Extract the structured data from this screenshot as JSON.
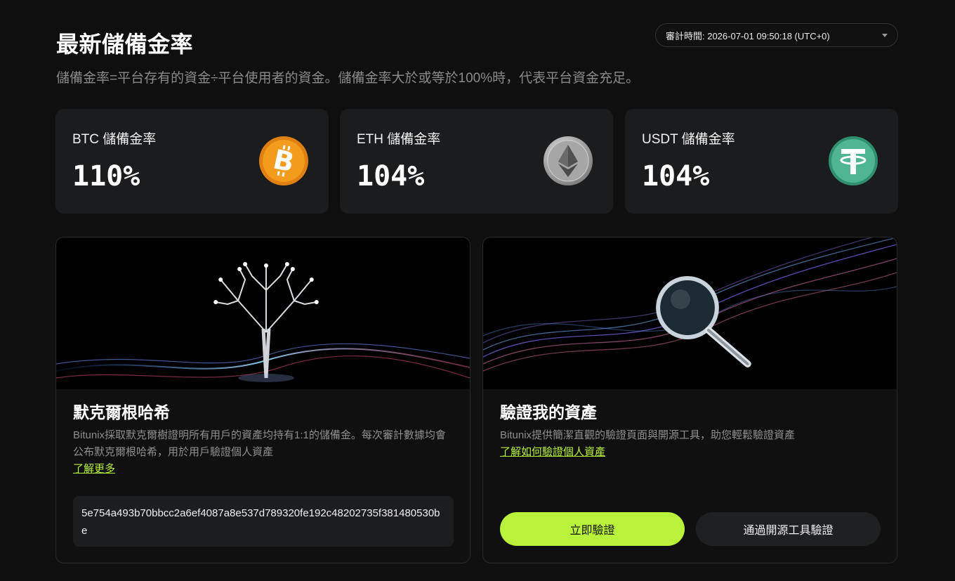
{
  "header": {
    "title": "最新儲備金率",
    "audit_time": "審計時間: 2026-07-01 09:50:18 (UTC+0)",
    "subtitle": "儲備金率=平台存有的資金÷平台使用者的資金。儲備金率大於或等於100%時，代表平台資金充足。"
  },
  "rates": [
    {
      "label": "BTC 儲備金率",
      "value": "110%",
      "icon": "bitcoin-icon",
      "color": "#f29b1c"
    },
    {
      "label": "ETH 儲備金率",
      "value": "104%",
      "icon": "ethereum-icon",
      "color": "#b5b5b5"
    },
    {
      "label": "USDT 儲備金率",
      "value": "104%",
      "icon": "tether-icon",
      "color": "#3faa87"
    }
  ],
  "merkle": {
    "title": "默克爾根哈希",
    "desc": "Bitunix採取默克爾樹證明所有用戶的資產均持有1:1的儲備金。每次審計數據均會公布默克爾根哈希，用於用戶驗證個人資產",
    "link": "了解更多",
    "hash": "5e754a493b70bbcc2a6ef4087a8e537d789320fe192c48202735f381480530be"
  },
  "verify": {
    "title": "驗證我的資產",
    "desc": "Bitunix提供簡潔直觀的驗證頁面與開源工具，助您輕鬆驗證資產",
    "link": "了解如何驗證個人資產",
    "primary_button": "立即驗證",
    "secondary_button": "通過開源工具驗證"
  },
  "colors": {
    "accent": "#b8f23a",
    "background": "#0f0f0f",
    "card": "#1b1c1e"
  }
}
